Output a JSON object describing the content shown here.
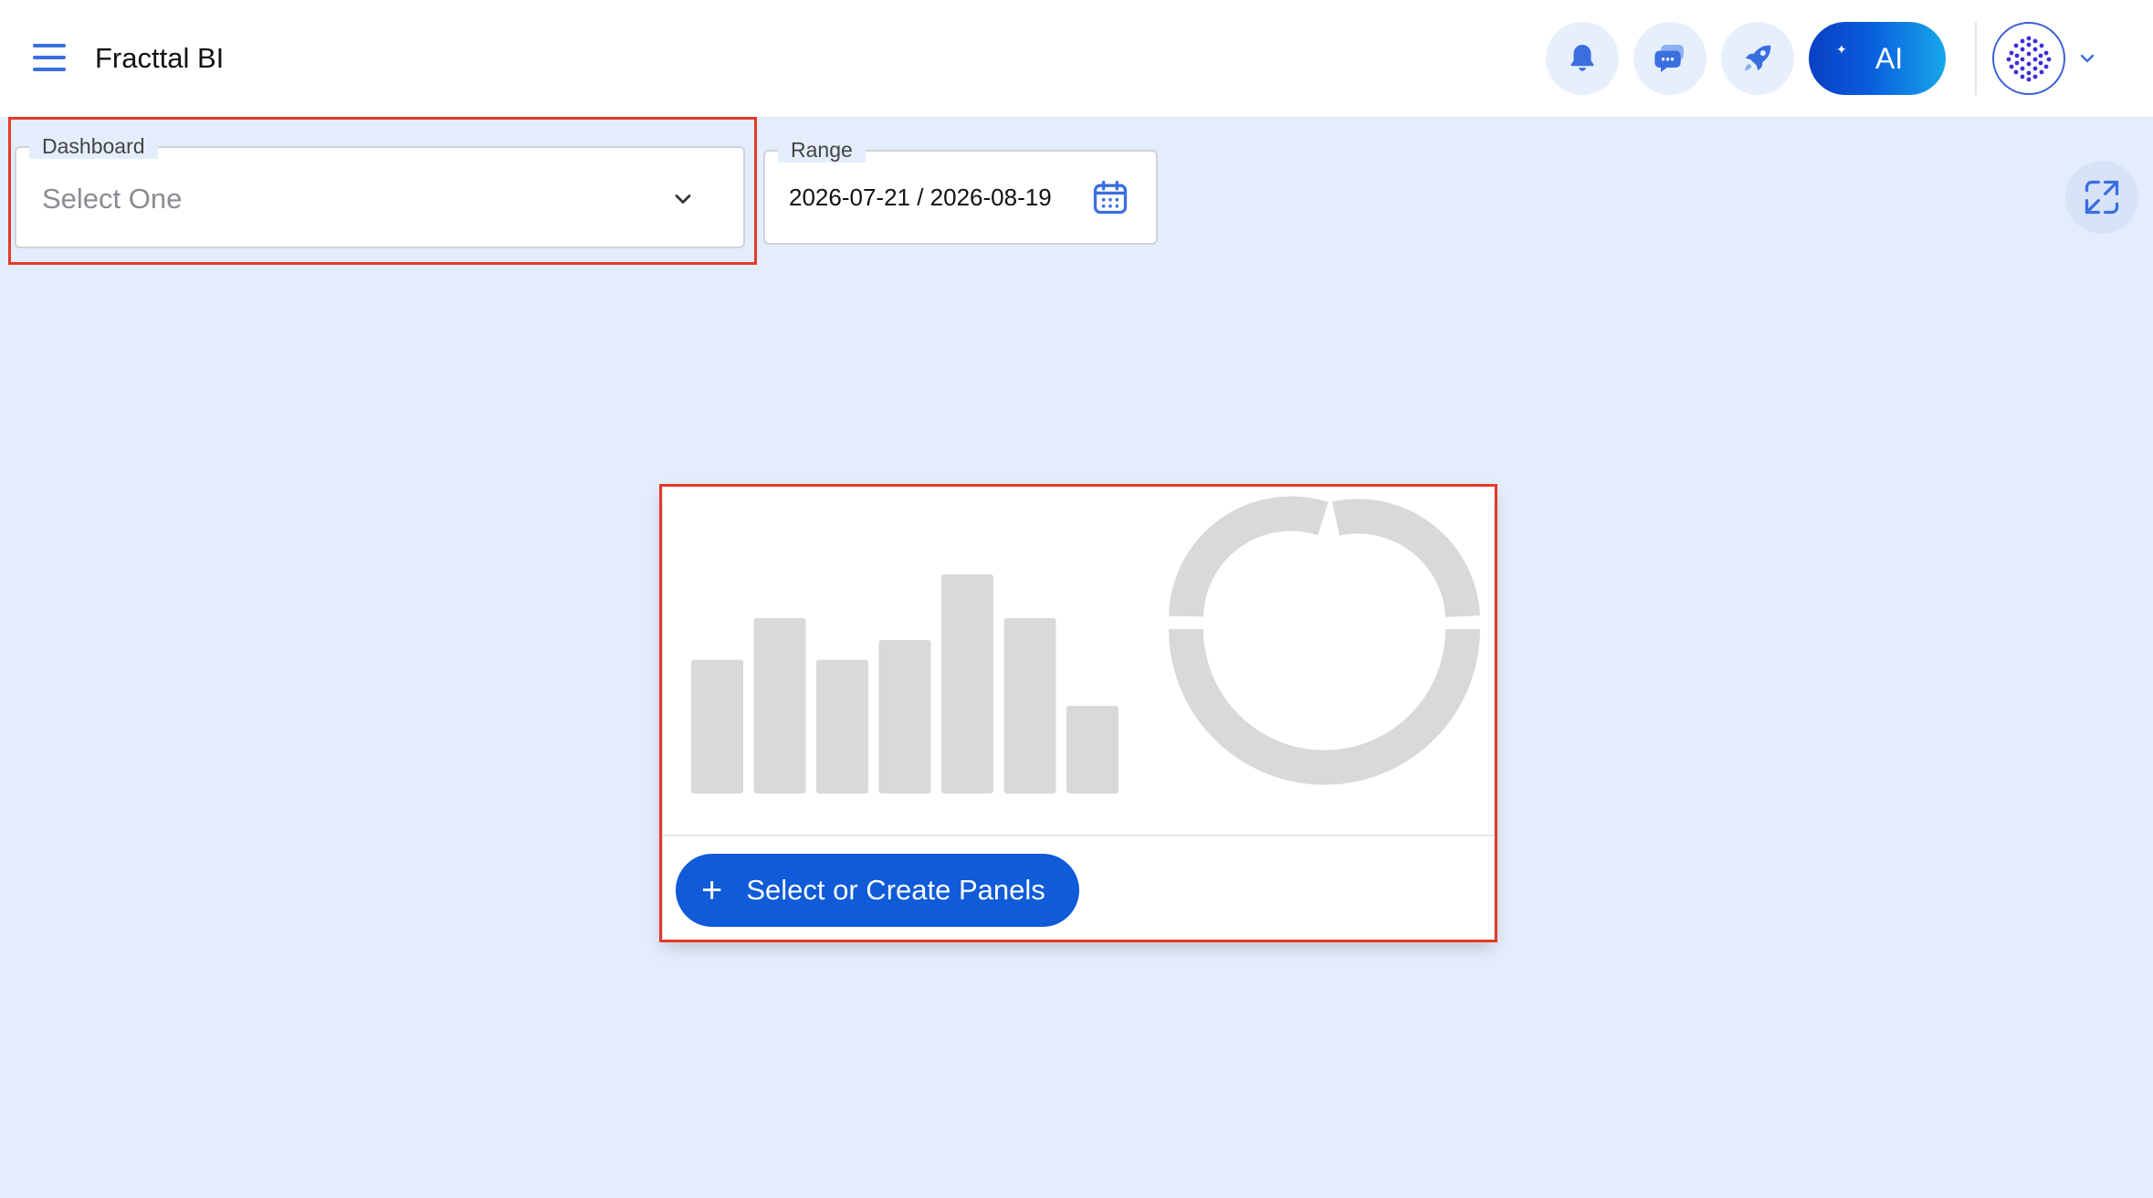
{
  "header": {
    "title": "Fracttal BI",
    "ai_label": "AI",
    "icons": {
      "menu": "hamburger-menu-icon",
      "notifications": "bell-icon",
      "chat": "chat-bubbles-icon",
      "launch": "rocket-icon",
      "avatar": "dotted-globe-logo-icon",
      "avatar_menu": "chevron-down-icon"
    }
  },
  "filters": {
    "dashboard": {
      "label": "Dashboard",
      "value": "Select One"
    },
    "range": {
      "label": "Range",
      "value": "2026-07-21 / 2026-08-19"
    },
    "icons": {
      "range": "calendar-icon",
      "expand": "expand-fullscreen-icon"
    }
  },
  "empty_state": {
    "button_label": "Select or Create Panels",
    "button_icon": "plus-icon",
    "illustration": {
      "bar_relative_heights": [
        0.61,
        0.8,
        0.61,
        0.7,
        1.0,
        0.8,
        0.4
      ],
      "donut": true
    }
  },
  "colors": {
    "accent": "#0f5bd8",
    "background": "#e4edfc",
    "highlight": "#e53a27",
    "placeholder_gray": "#d9d9d9"
  }
}
